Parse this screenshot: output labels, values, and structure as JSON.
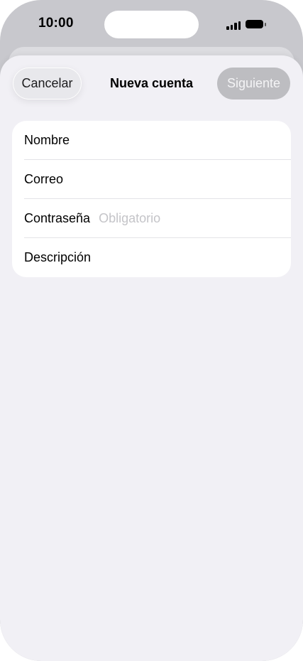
{
  "status_bar": {
    "time": "10:00"
  },
  "nav": {
    "cancel_label": "Cancelar",
    "title": "Nueva cuenta",
    "next_label": "Siguiente"
  },
  "form": {
    "fields": [
      {
        "label": "Nombre",
        "placeholder": ""
      },
      {
        "label": "Correo",
        "placeholder": ""
      },
      {
        "label": "Contraseña",
        "placeholder": "Obligatorio"
      },
      {
        "label": "Descripción",
        "placeholder": ""
      }
    ]
  },
  "colors": {
    "sheet_background": "#f1f0f5",
    "next_button_disabled": "#bdbdc1",
    "placeholder_text": "#c4c4c8"
  }
}
